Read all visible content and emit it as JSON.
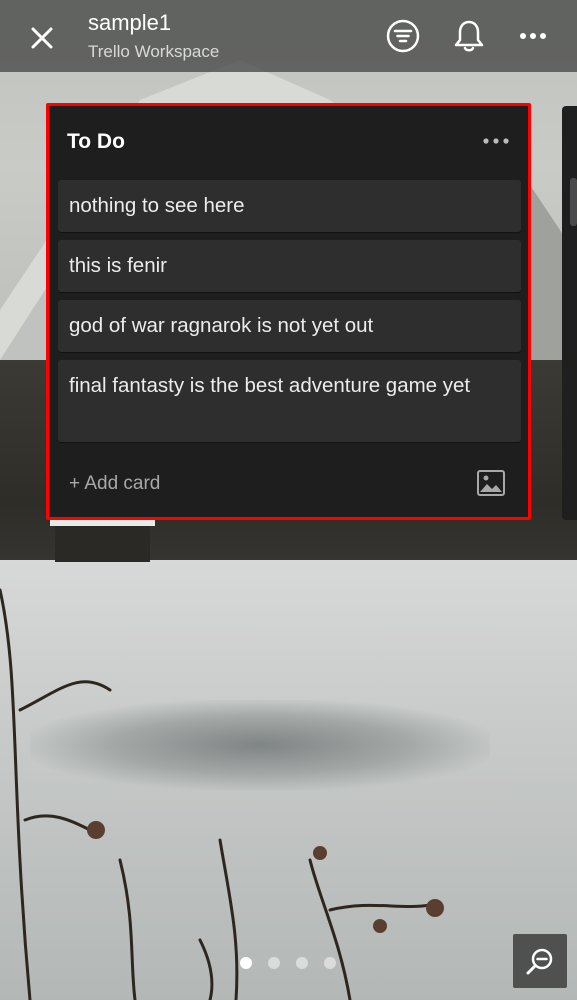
{
  "header": {
    "board_title": "sample1",
    "workspace_name": "Trello Workspace",
    "icons": [
      "close-icon",
      "filter-icon",
      "bell-icon",
      "more-icon"
    ]
  },
  "list": {
    "title": "To Do",
    "cards": [
      {
        "text": "nothing to see here"
      },
      {
        "text": "this is fenir"
      },
      {
        "text": "god of war ragnarok is not yet out"
      },
      {
        "text": "final fantasty is the best adventure game yet"
      }
    ],
    "add_card_label": "+ Add card",
    "highlight_color": "#ff0000"
  },
  "pagination": {
    "total": 4,
    "active_index": 0
  },
  "colors": {
    "list_bg": "#1e1e1e",
    "card_bg": "#2e2e2e",
    "topbar_bg": "#464846"
  }
}
